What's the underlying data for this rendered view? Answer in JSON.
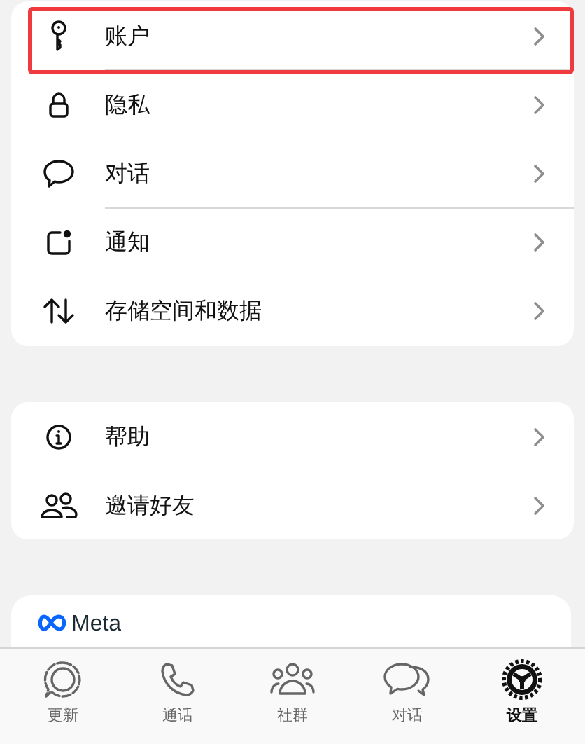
{
  "groups": [
    {
      "items": [
        {
          "label": "账户",
          "highlighted": true,
          "divider_below": true
        },
        {
          "label": "隐私",
          "highlighted": false,
          "divider_below": false
        },
        {
          "label": "对话",
          "highlighted": false,
          "divider_below": true
        },
        {
          "label": "通知",
          "highlighted": false,
          "divider_below": false
        },
        {
          "label": "存储空间和数据",
          "highlighted": false,
          "divider_below": false
        }
      ]
    },
    {
      "items": [
        {
          "label": "帮助",
          "highlighted": false,
          "divider_below": false
        },
        {
          "label": "邀请好友",
          "highlighted": false,
          "divider_below": false
        }
      ]
    }
  ],
  "footer": {
    "brand": "Meta"
  },
  "tab_bar": [
    {
      "label": "更新",
      "selected": false
    },
    {
      "label": "通话",
      "selected": false
    },
    {
      "label": "社群",
      "selected": false
    },
    {
      "label": "对话",
      "selected": false
    },
    {
      "label": "设置",
      "selected": true
    }
  ]
}
